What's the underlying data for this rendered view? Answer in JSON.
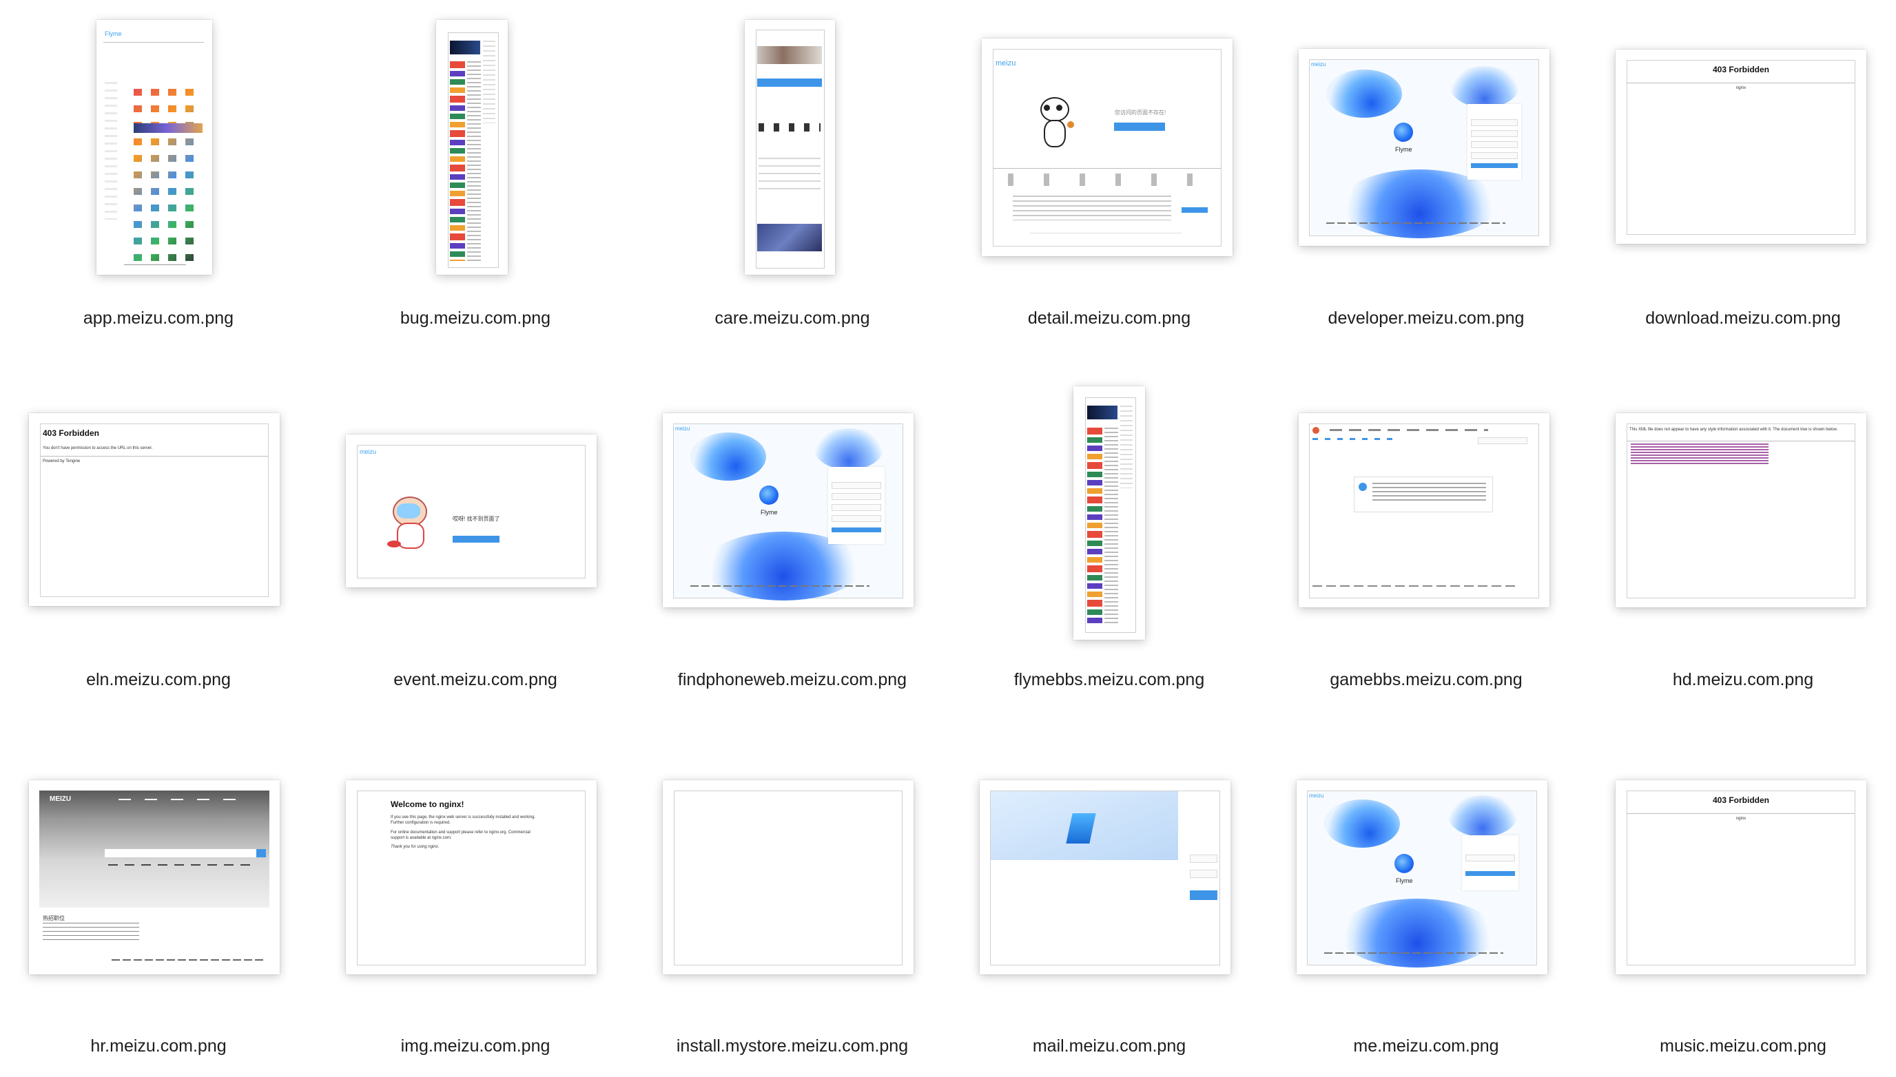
{
  "files": [
    {
      "name": "app.meizu.com.png"
    },
    {
      "name": "bug.meizu.com.png"
    },
    {
      "name": "care.meizu.com.png"
    },
    {
      "name": "detail.meizu.com.png"
    },
    {
      "name": "developer.meizu.com.png"
    },
    {
      "name": "download.meizu.com.png"
    },
    {
      "name": "eln.meizu.com.png"
    },
    {
      "name": "event.meizu.com.png"
    },
    {
      "name": "findphoneweb.meizu.com.png"
    },
    {
      "name": "flymebbs.meizu.com.png"
    },
    {
      "name": "gamebbs.meizu.com.png"
    },
    {
      "name": "hd.meizu.com.png"
    },
    {
      "name": "hr.meizu.com.png"
    },
    {
      "name": "img.meizu.com.png"
    },
    {
      "name": "install.mystore.meizu.com.png"
    },
    {
      "name": "mail.meizu.com.png"
    },
    {
      "name": "me.meizu.com.png"
    },
    {
      "name": "music.meizu.com.png"
    }
  ],
  "previews": {
    "app_logo": "Flyme",
    "detail_logo": "meizu",
    "detail_message": "您访问的页面不存在!",
    "developer_logo": "meizu",
    "developer_brand": "Flyme",
    "download_title": "403 Forbidden",
    "download_server": "nginx",
    "eln_title": "403 Forbidden",
    "eln_message": "You don't have permission to access the URL on this server.",
    "eln_footer": "Powered by Tengine",
    "event_logo": "meizu",
    "event_message": "哎呀! 找不到页面了",
    "findphone_logo": "meizu",
    "findphone_brand": "Flyme",
    "hd_message": "This XML file does not appear to have any style information associated with it. The document tree is shown below.",
    "hr_logo": "MEIZU",
    "hr_section": "热招职位",
    "img_title": "Welcome to nginx!",
    "img_p1": "If you see this page, the nginx web server is successfully installed and working. Further configuration is required.",
    "img_p2": "For online documentation and support please refer to nginx.org. Commercial support is available at nginx.com.",
    "img_p3": "Thank you for using nginx.",
    "me_logo": "meizu",
    "me_brand": "Flyme",
    "music_title": "403 Forbidden",
    "music_server": "nginx"
  },
  "colors": {
    "accent": "#3e95e8",
    "meizu_blue": "#3ba0ec",
    "label_text": "#1d1d1d"
  }
}
